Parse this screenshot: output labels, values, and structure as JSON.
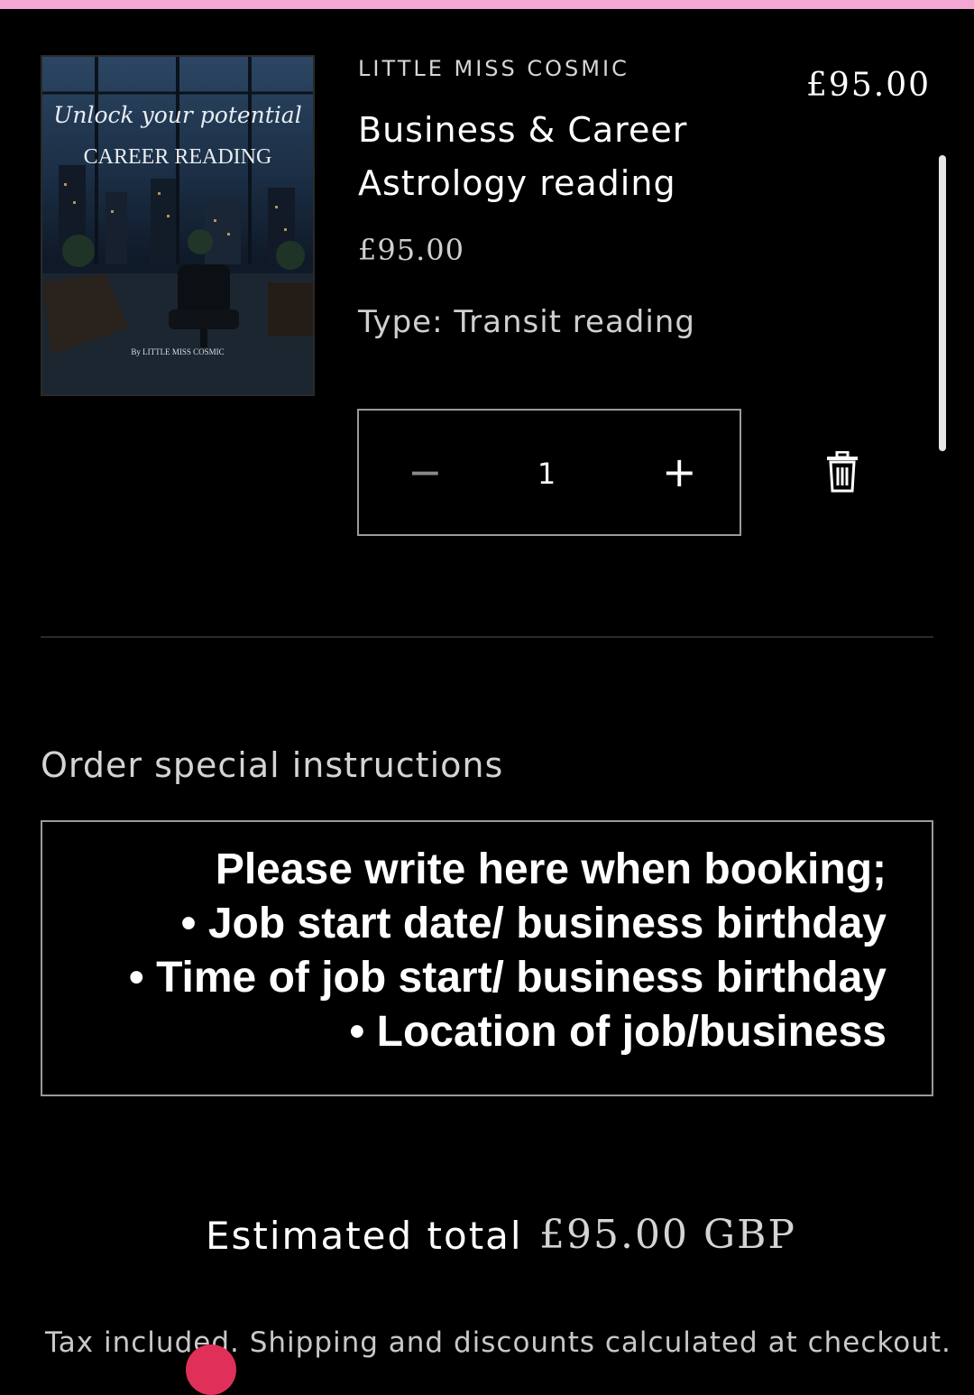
{
  "colors": {
    "background": "#000000",
    "top_bar": "#f4a6d4",
    "text": "#ffffff",
    "muted_text": "#cfcfcf",
    "border": "#9a9a9a",
    "chat_bubble": "#e0305a"
  },
  "cart_item": {
    "image": {
      "script_title": "Unlock your potential",
      "title": "CAREER READING",
      "byline": "By LITTLE MISS COSMIC"
    },
    "vendor": "LITTLE MISS COSMIC",
    "title": "Business & Career Astrology reading",
    "unit_price": "£95.00",
    "line_price": "£95.00",
    "variant": "Type: Transit reading",
    "quantity": {
      "value": "1",
      "decrease_icon": "minus-icon",
      "decrease_symbol": "−",
      "increase_icon": "plus-icon",
      "increase_symbol": "+"
    },
    "remove_icon": "trash-icon"
  },
  "notes": {
    "label": "Order special instructions",
    "value": "Please write here when booking;\n• Job start date/ business birthday\n• Time of job start/ business birthday\n• Location of job/business"
  },
  "totals": {
    "label": "Estimated total",
    "value": "£95.00 GBP",
    "tax_note": "Tax included. Shipping and discounts calculated at checkout."
  }
}
